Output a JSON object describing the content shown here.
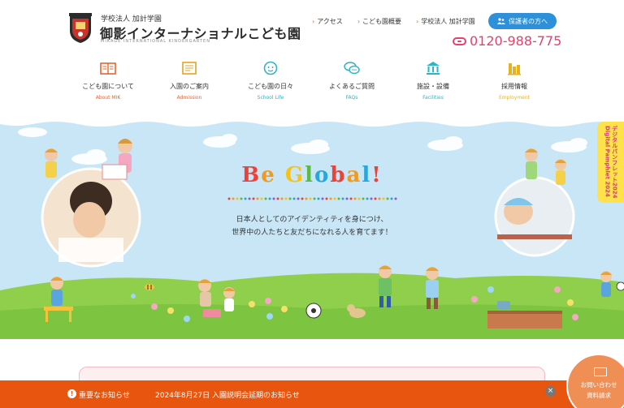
{
  "logo": {
    "sub": "学校法人 加計学園",
    "main": "御影インターナショナルこども園",
    "en": "MIKAGE INTERNATIONAL KINDERGARTEN"
  },
  "toplinks": [
    "アクセス",
    "こども園概要",
    "学校法人 加計学園"
  ],
  "parent_button": "保護者の方へ",
  "phone": "0120-988-775",
  "nav": [
    {
      "label": "こども園について",
      "en": "About MIK",
      "color": "#e5652f",
      "icon": "book-icon"
    },
    {
      "label": "入園のご案内",
      "en": "Admission",
      "color": "#e5652f",
      "icon": "document-icon"
    },
    {
      "label": "こども園の日々",
      "en": "School Life",
      "color": "#2fb3c5",
      "icon": "child-face-icon"
    },
    {
      "label": "よくあるご質問",
      "en": "FAQs",
      "color": "#2fb3c5",
      "icon": "chat-icon"
    },
    {
      "label": "施設・設備",
      "en": "Facilities",
      "color": "#2fb3c5",
      "icon": "building-icon"
    },
    {
      "label": "採用情報",
      "en": "Employment",
      "color": "#e8b11f",
      "icon": "briefcase-icon"
    }
  ],
  "hero": {
    "headline_chars": [
      {
        "c": "B",
        "color": "#e9443a"
      },
      {
        "c": "e",
        "color": "#f19a1f"
      },
      {
        "c": " ",
        "color": "#ffffff"
      },
      {
        "c": "G",
        "color": "#f4c21a"
      },
      {
        "c": "l",
        "color": "#5db84a"
      },
      {
        "c": "o",
        "color": "#2aa6d9"
      },
      {
        "c": "b",
        "color": "#e9443a"
      },
      {
        "c": "a",
        "color": "#f19a1f"
      },
      {
        "c": "l",
        "color": "#2aa6d9"
      },
      {
        "c": "!",
        "color": "#e9443a"
      }
    ],
    "line1": "日本人としてのアイデンティティを身につけ、",
    "line2": "世界中の人たちと友だちになれる人を育てます！"
  },
  "side_tab": {
    "line1": "デジタルパンフレット2024",
    "line2": "Digital Pamphlet 2024"
  },
  "notice": {
    "label": "重要なお知らせ",
    "text": "2024年8月27日 入園説明会延期のお知らせ",
    "close": "×"
  },
  "contact": {
    "line1": "お問い合わせ",
    "line2": "資料請求"
  },
  "colors": {
    "accent_orange": "#e8550f",
    "brand_blue": "#2e90d8",
    "phone_pink": "#e5416a",
    "sky": "#c8e6f5",
    "grass": "#8fcf4b"
  }
}
